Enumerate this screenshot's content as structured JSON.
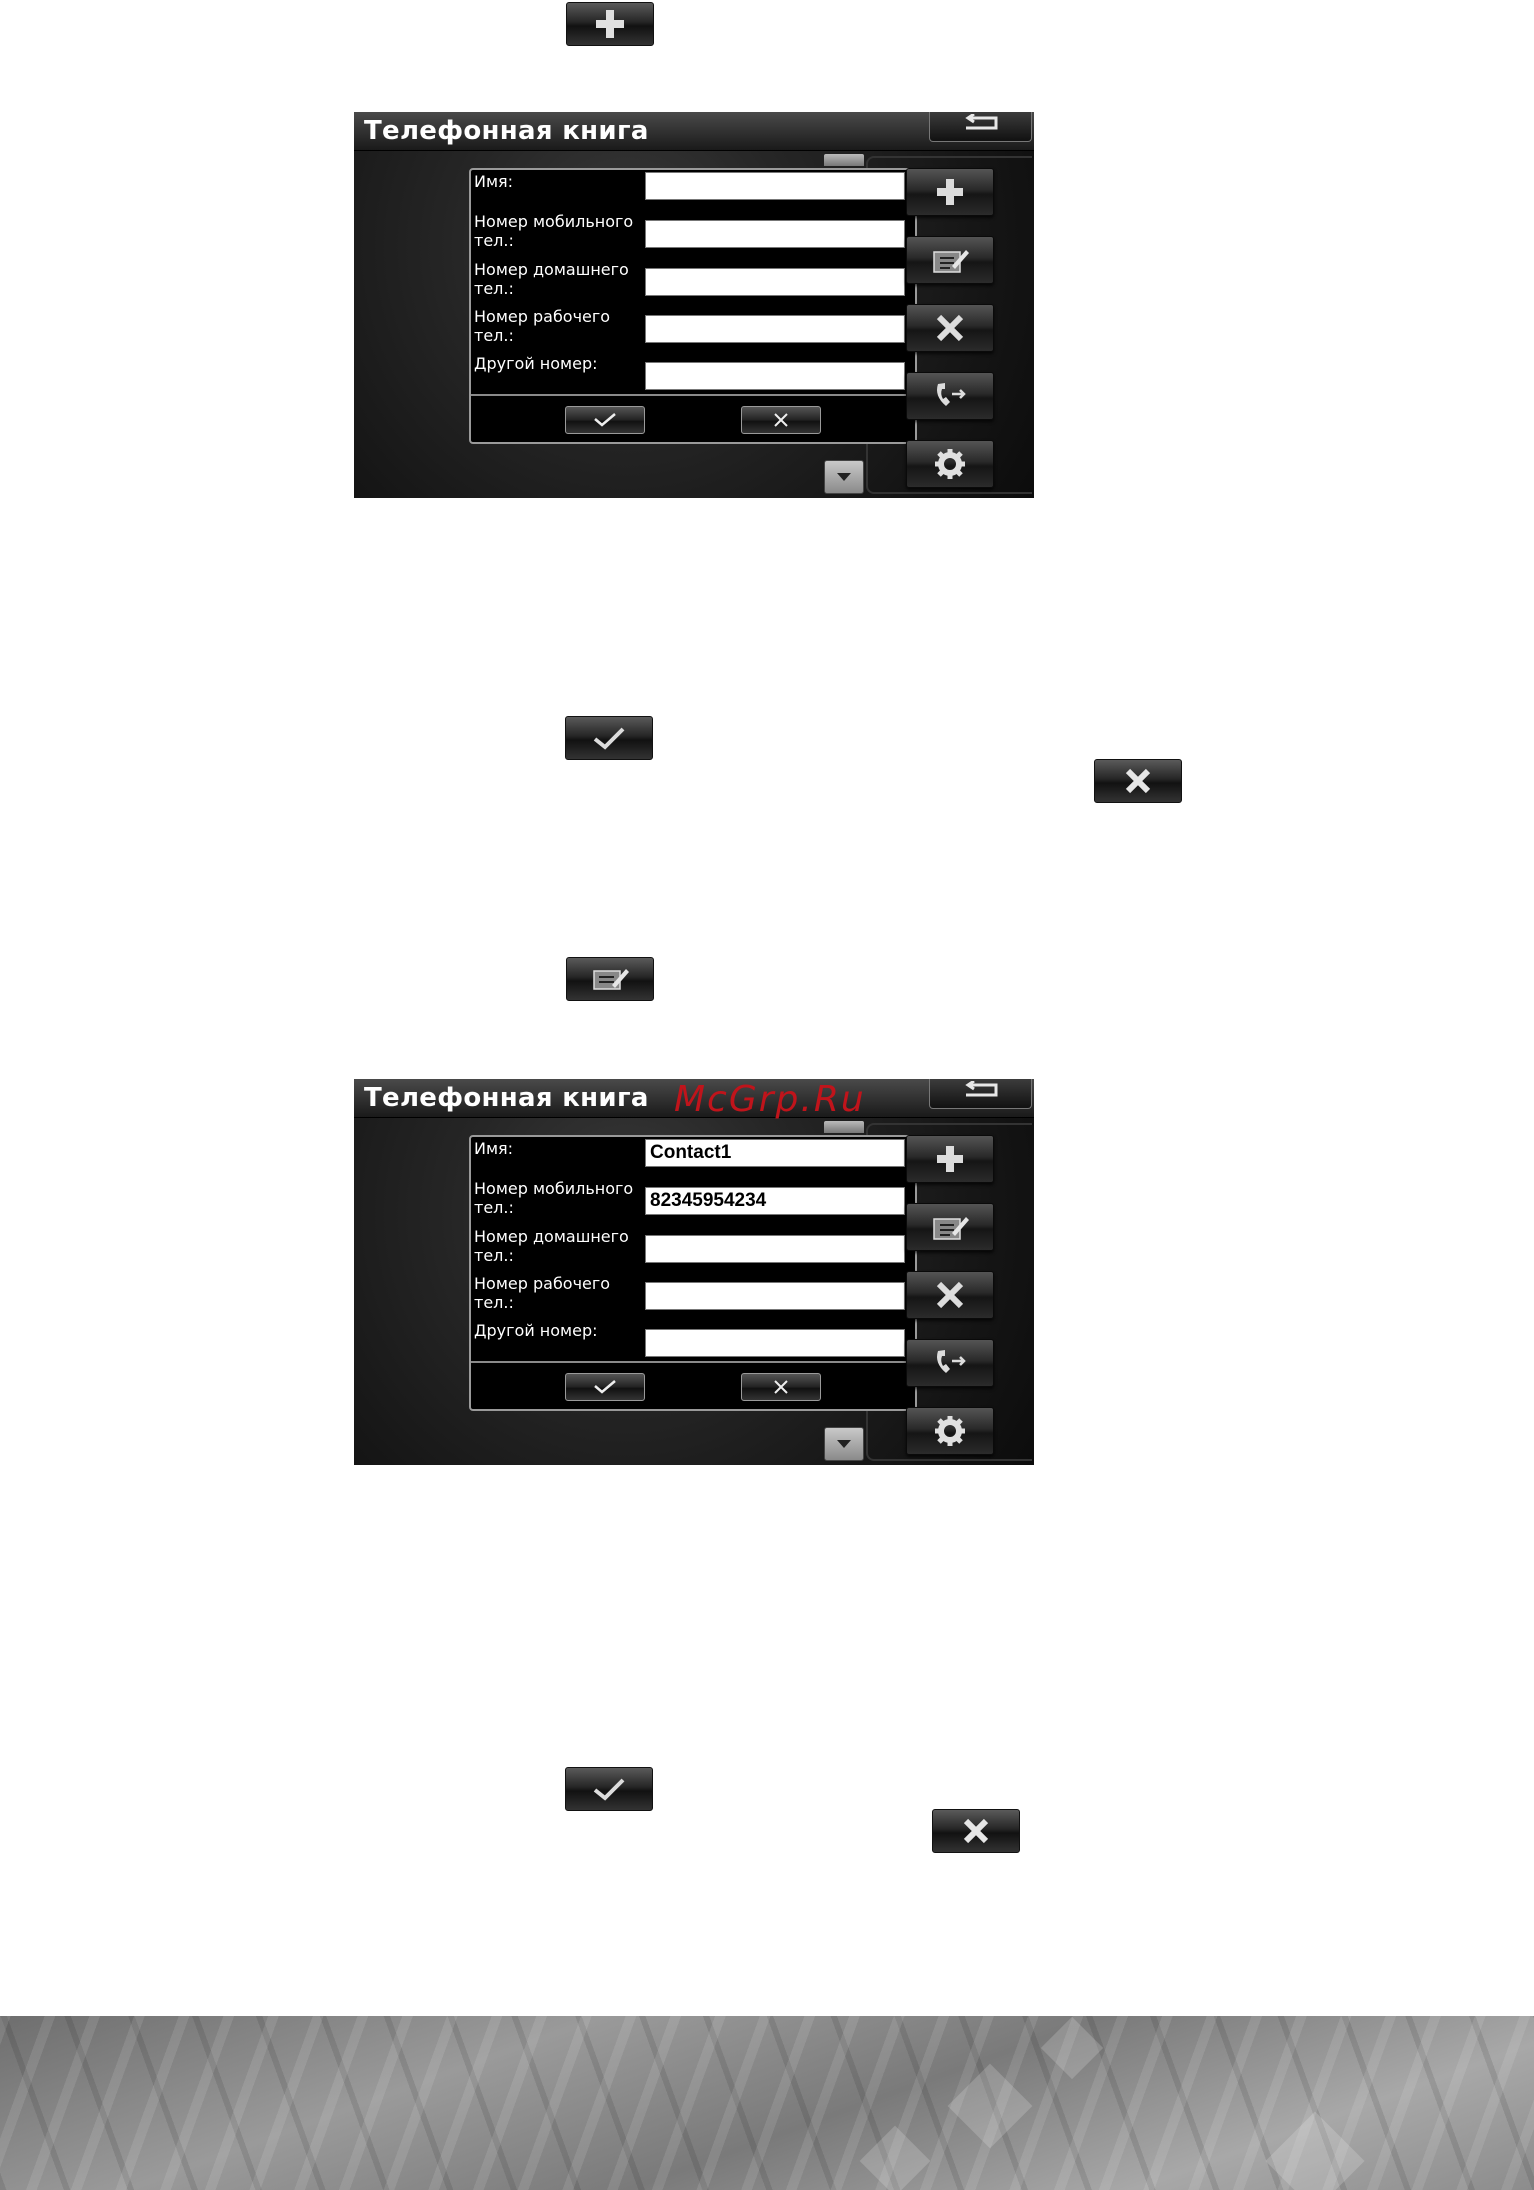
{
  "instructions": {
    "add_icon": "plus-icon",
    "confirm_icon": "check-icon",
    "cancel_icon": "cross-icon",
    "edit_icon": "edit-contact-icon"
  },
  "screens": [
    {
      "title": "Телефонная книга",
      "watermark": "",
      "fields": [
        {
          "label": "Имя:",
          "value": ""
        },
        {
          "label": "Номер мобильного тел.:",
          "value": ""
        },
        {
          "label": "Номер домашнего тел.:",
          "value": ""
        },
        {
          "label": "Номер рабочего тел.:",
          "value": ""
        },
        {
          "label": "Другой номер:",
          "value": ""
        }
      ],
      "side_buttons": [
        "plus-icon",
        "edit-contact-icon",
        "delete-icon",
        "call-transfer-icon",
        "settings-gear-icon"
      ]
    },
    {
      "title": "Телефонная книга",
      "watermark": "McGrp.Ru",
      "fields": [
        {
          "label": "Имя:",
          "value": "Contact1"
        },
        {
          "label": "Номер мобильного тел.:",
          "value": "82345954234"
        },
        {
          "label": "Номер домашнего тел.:",
          "value": ""
        },
        {
          "label": "Номер рабочего тел.:",
          "value": ""
        },
        {
          "label": "Другой номер:",
          "value": ""
        }
      ],
      "side_buttons": [
        "plus-icon",
        "edit-contact-icon",
        "delete-icon",
        "call-transfer-icon",
        "settings-gear-icon"
      ]
    }
  ]
}
